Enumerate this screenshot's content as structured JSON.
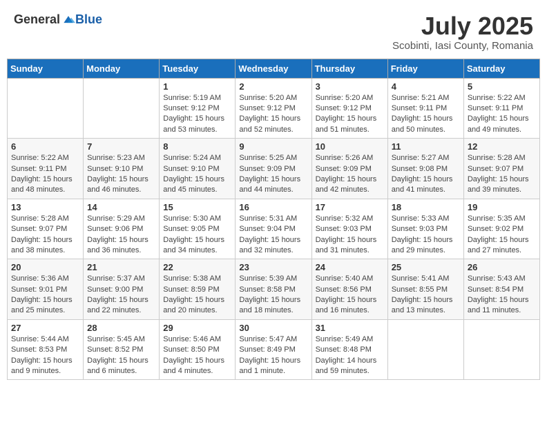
{
  "header": {
    "logo_general": "General",
    "logo_blue": "Blue",
    "month": "July 2025",
    "location": "Scobinti, Iasi County, Romania"
  },
  "weekdays": [
    "Sunday",
    "Monday",
    "Tuesday",
    "Wednesday",
    "Thursday",
    "Friday",
    "Saturday"
  ],
  "weeks": [
    [
      {
        "day": "",
        "info": ""
      },
      {
        "day": "",
        "info": ""
      },
      {
        "day": "1",
        "info": "Sunrise: 5:19 AM\nSunset: 9:12 PM\nDaylight: 15 hours and 53 minutes."
      },
      {
        "day": "2",
        "info": "Sunrise: 5:20 AM\nSunset: 9:12 PM\nDaylight: 15 hours and 52 minutes."
      },
      {
        "day": "3",
        "info": "Sunrise: 5:20 AM\nSunset: 9:12 PM\nDaylight: 15 hours and 51 minutes."
      },
      {
        "day": "4",
        "info": "Sunrise: 5:21 AM\nSunset: 9:11 PM\nDaylight: 15 hours and 50 minutes."
      },
      {
        "day": "5",
        "info": "Sunrise: 5:22 AM\nSunset: 9:11 PM\nDaylight: 15 hours and 49 minutes."
      }
    ],
    [
      {
        "day": "6",
        "info": "Sunrise: 5:22 AM\nSunset: 9:11 PM\nDaylight: 15 hours and 48 minutes."
      },
      {
        "day": "7",
        "info": "Sunrise: 5:23 AM\nSunset: 9:10 PM\nDaylight: 15 hours and 46 minutes."
      },
      {
        "day": "8",
        "info": "Sunrise: 5:24 AM\nSunset: 9:10 PM\nDaylight: 15 hours and 45 minutes."
      },
      {
        "day": "9",
        "info": "Sunrise: 5:25 AM\nSunset: 9:09 PM\nDaylight: 15 hours and 44 minutes."
      },
      {
        "day": "10",
        "info": "Sunrise: 5:26 AM\nSunset: 9:09 PM\nDaylight: 15 hours and 42 minutes."
      },
      {
        "day": "11",
        "info": "Sunrise: 5:27 AM\nSunset: 9:08 PM\nDaylight: 15 hours and 41 minutes."
      },
      {
        "day": "12",
        "info": "Sunrise: 5:28 AM\nSunset: 9:07 PM\nDaylight: 15 hours and 39 minutes."
      }
    ],
    [
      {
        "day": "13",
        "info": "Sunrise: 5:28 AM\nSunset: 9:07 PM\nDaylight: 15 hours and 38 minutes."
      },
      {
        "day": "14",
        "info": "Sunrise: 5:29 AM\nSunset: 9:06 PM\nDaylight: 15 hours and 36 minutes."
      },
      {
        "day": "15",
        "info": "Sunrise: 5:30 AM\nSunset: 9:05 PM\nDaylight: 15 hours and 34 minutes."
      },
      {
        "day": "16",
        "info": "Sunrise: 5:31 AM\nSunset: 9:04 PM\nDaylight: 15 hours and 32 minutes."
      },
      {
        "day": "17",
        "info": "Sunrise: 5:32 AM\nSunset: 9:03 PM\nDaylight: 15 hours and 31 minutes."
      },
      {
        "day": "18",
        "info": "Sunrise: 5:33 AM\nSunset: 9:03 PM\nDaylight: 15 hours and 29 minutes."
      },
      {
        "day": "19",
        "info": "Sunrise: 5:35 AM\nSunset: 9:02 PM\nDaylight: 15 hours and 27 minutes."
      }
    ],
    [
      {
        "day": "20",
        "info": "Sunrise: 5:36 AM\nSunset: 9:01 PM\nDaylight: 15 hours and 25 minutes."
      },
      {
        "day": "21",
        "info": "Sunrise: 5:37 AM\nSunset: 9:00 PM\nDaylight: 15 hours and 22 minutes."
      },
      {
        "day": "22",
        "info": "Sunrise: 5:38 AM\nSunset: 8:59 PM\nDaylight: 15 hours and 20 minutes."
      },
      {
        "day": "23",
        "info": "Sunrise: 5:39 AM\nSunset: 8:58 PM\nDaylight: 15 hours and 18 minutes."
      },
      {
        "day": "24",
        "info": "Sunrise: 5:40 AM\nSunset: 8:56 PM\nDaylight: 15 hours and 16 minutes."
      },
      {
        "day": "25",
        "info": "Sunrise: 5:41 AM\nSunset: 8:55 PM\nDaylight: 15 hours and 13 minutes."
      },
      {
        "day": "26",
        "info": "Sunrise: 5:43 AM\nSunset: 8:54 PM\nDaylight: 15 hours and 11 minutes."
      }
    ],
    [
      {
        "day": "27",
        "info": "Sunrise: 5:44 AM\nSunset: 8:53 PM\nDaylight: 15 hours and 9 minutes."
      },
      {
        "day": "28",
        "info": "Sunrise: 5:45 AM\nSunset: 8:52 PM\nDaylight: 15 hours and 6 minutes."
      },
      {
        "day": "29",
        "info": "Sunrise: 5:46 AM\nSunset: 8:50 PM\nDaylight: 15 hours and 4 minutes."
      },
      {
        "day": "30",
        "info": "Sunrise: 5:47 AM\nSunset: 8:49 PM\nDaylight: 15 hours and 1 minute."
      },
      {
        "day": "31",
        "info": "Sunrise: 5:49 AM\nSunset: 8:48 PM\nDaylight: 14 hours and 59 minutes."
      },
      {
        "day": "",
        "info": ""
      },
      {
        "day": "",
        "info": ""
      }
    ]
  ]
}
